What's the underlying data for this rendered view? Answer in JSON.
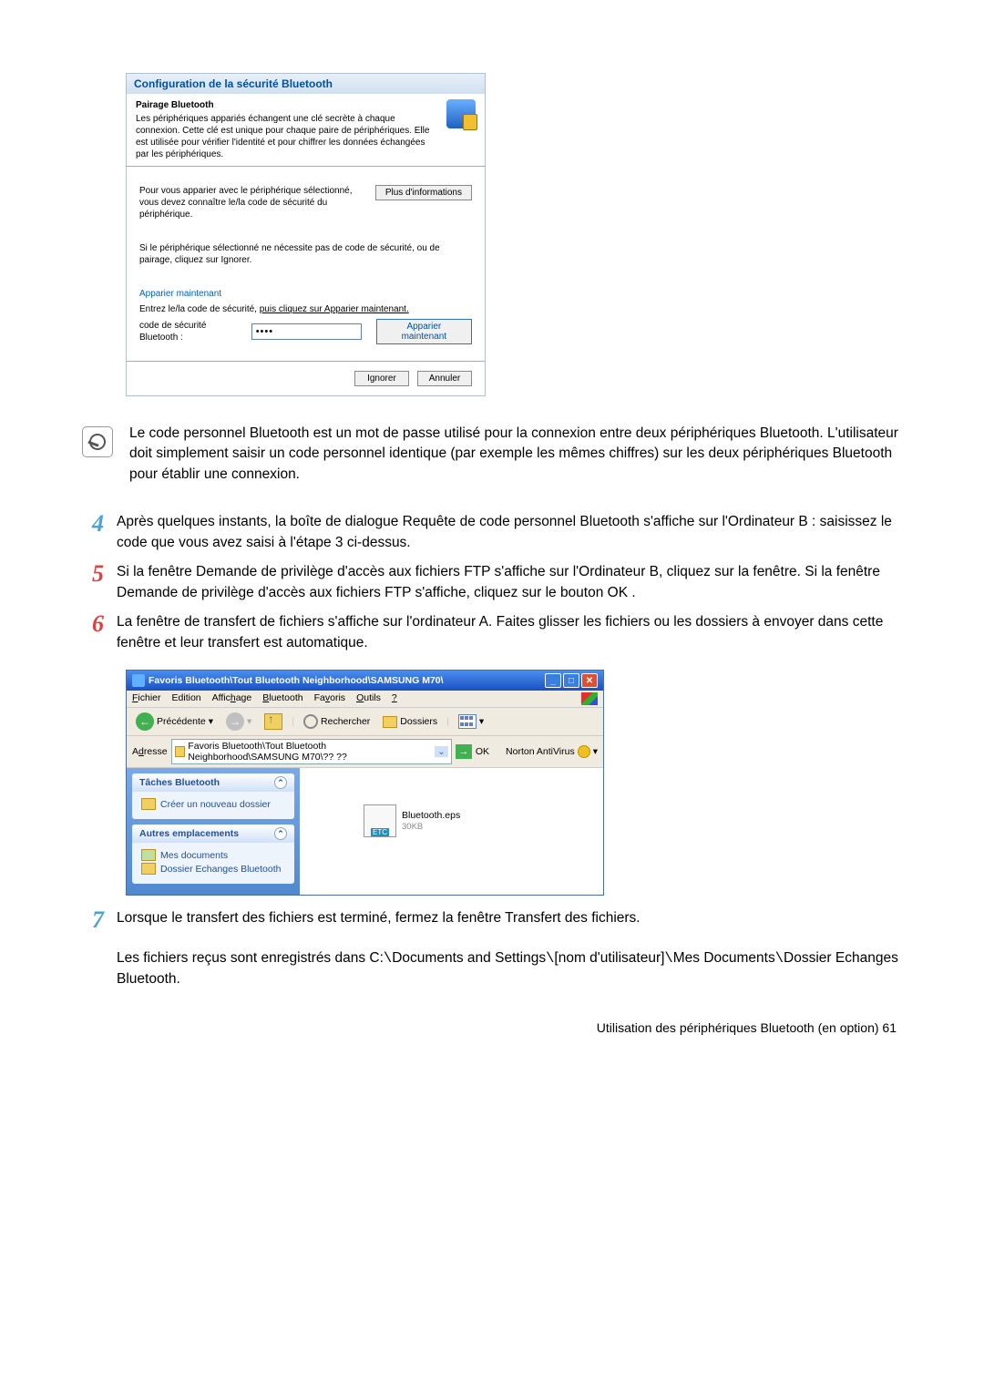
{
  "dialog1": {
    "title": "Configuration de la sécurité Bluetooth",
    "header_title": "Pairage Bluetooth",
    "header_desc": "Les périphériques appariés échangent une clé secrète à chaque connexion. Cette clé est unique pour chaque paire de périphériques. Elle est utilisée pour vérifier l'identité et pour chiffrer les données échangées par les périphériques.",
    "body1": "Pour vous apparier avec le périphérique sélectionné, vous devez connaître le/la code de sécurité du périphérique.",
    "more_info_btn": "Plus d'informations",
    "body2": "Si le périphérique sélectionné ne nécessite pas de code de sécurité, ou de pairage, cliquez sur Ignorer.",
    "pair_now_link": "Apparier maintenant",
    "instruction": "Entrez le/la code de sécurité, ",
    "instruction_underline": "puis cliquez sur Apparier maintenant.",
    "code_label": "code de sécurité Bluetooth :",
    "code_value": "••••",
    "pair_btn": "Apparier maintenant",
    "skip_btn": "Ignorer",
    "cancel_btn": "Annuler"
  },
  "note": "Le code personnel Bluetooth est un mot de passe utilisé pour la connexion entre deux périphériques Bluetooth. L'utilisateur doit simplement saisir un code personnel identique (par exemple les mêmes chiffres) sur les deux périphériques Bluetooth pour établir une connexion.",
  "steps": {
    "s4": "Après quelques instants, la boîte de dialogue Requête de code personnel Bluetooth s'affiche sur l'Ordinateur B : saisissez le code que vous avez saisi à l'étape 3 ci-dessus.",
    "s5": "Si la fenêtre Demande de privilège d'accès aux fichiers FTP s'affiche sur l'Ordinateur B, cliquez sur la fenêtre. Si la fenêtre Demande de privilège d'accès aux fichiers FTP s'affiche, cliquez sur le bouton OK .",
    "s6": "La fenêtre de transfert de fichiers s'affiche sur l'ordinateur A. Faites glisser les fichiers ou les dossiers à envoyer dans cette fenêtre et leur transfert est automatique.",
    "s7": "Lorsque le transfert des fichiers est terminé, fermez la fenêtre Transfert des fichiers.",
    "s7b_a": "Les fichiers reçus sont enregistrés dans C:",
    "s7b_b": "Documents and Settings",
    "s7b_c": "[nom d'utilisateur]",
    "s7b_d": "Mes Documents",
    "s7b_e": "Dossier Echanges Bluetooth."
  },
  "explorer": {
    "title": "Favoris Bluetooth\\Tout Bluetooth Neighborhood\\SAMSUNG M70\\",
    "menu": {
      "file": "Fichier",
      "edit": "Edition",
      "view": "Affichage",
      "bluetooth": "Bluetooth",
      "fav": "Favoris",
      "tools": "Outils",
      "help": "?"
    },
    "toolbar": {
      "back": "Précédente",
      "search": "Rechercher",
      "folders": "Dossiers"
    },
    "addr_label": "Adresse",
    "addr_value": "Favoris Bluetooth\\Tout Bluetooth Neighborhood\\SAMSUNG M70\\?? ??",
    "ok": "OK",
    "norton": "Norton AntiVirus",
    "panel1_title": "Tâches Bluetooth",
    "panel1_item": "Créer un nouveau dossier",
    "panel2_title": "Autres emplacements",
    "panel2_item1": "Mes documents",
    "panel2_item2": "Dossier Echanges Bluetooth",
    "file_name": "Bluetooth.eps",
    "file_size": "30KB",
    "etc": "ETC"
  },
  "footer": "Utilisation des périphériques Bluetooth (en option)   61"
}
